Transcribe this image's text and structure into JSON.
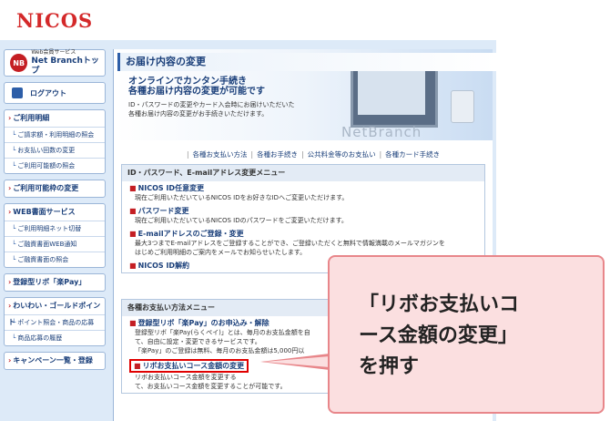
{
  "header": {
    "logo": "NICOS"
  },
  "sidebar": {
    "top": {
      "service_label": "Web会員サービス",
      "title": "Net Branchトップ",
      "badge": "NB"
    },
    "logout_label": "ログアウト",
    "sections": [
      {
        "title": "ご利用明細",
        "items": [
          "ご請求額・利用明細の照会",
          "お支払い回数の変更",
          "ご利用可能額の照会"
        ]
      },
      {
        "title": "ご利用可能枠の変更",
        "items": []
      },
      {
        "title": "WEB書面サービス",
        "items": [
          "ご利用明細ネット切替",
          "ご融資書面WEB通知",
          "ご融資書面の照会"
        ]
      },
      {
        "title": "登録型リボ「楽Pay」",
        "items": []
      },
      {
        "title": "わいわい・ゴールドポイント",
        "items": [
          "ポイント照会・商品の応募",
          "商品応募の履歴"
        ]
      },
      {
        "title": "キャンペーン一覧・登録",
        "items": []
      }
    ]
  },
  "main": {
    "page_title": "お届け内容の変更",
    "banner_heading_1": "オンラインでカンタン手続き",
    "banner_heading_2": "各種お届け内容の変更が可能です",
    "banner_text_1": "ID・パスワードの変更やカード入会時にお届けいただいた",
    "banner_text_2": "各種お届け内容の変更がお手続きいただけます。",
    "brand_mark": "NetBranch",
    "links": [
      "各種お支払い方法",
      "各種お手続き",
      "公共料金等のお支払い",
      "各種カード手続き"
    ],
    "panel1": {
      "title": "ID・パスワード、E-mailアドレス変更メニュー",
      "items": [
        {
          "title": "NICOS ID任意変更",
          "desc": [
            "現在ご利用いただいているNICOS IDをお好きなIDへご変更いただけます。"
          ]
        },
        {
          "title": "パスワード変更",
          "desc": [
            "現在ご利用いただいているNICOS IDのパスワードをご変更いただけます。"
          ]
        },
        {
          "title": "E-mailアドレスのご登録・変更",
          "desc": [
            "最大3つまでE-mailアドレスをご登録することができ、ご登録いただくと無料で情報満載のメールマガジンを",
            "はじめご利用明細のご案内をメールでお知らせいたします。"
          ]
        },
        {
          "title": "NICOS ID解約",
          "desc": []
        }
      ]
    },
    "panel2": {
      "title": "各種お支払い方法メニュー",
      "items": [
        {
          "title": "登録型リボ「楽Pay」のお申込み・解除",
          "desc": [
            "登録型リボ「楽Pay(らくペイ)」とは、毎月のお支払金額を自",
            "て、自由に設定・変更できるサービスです。",
            "「楽Pay」のご登録は無料、毎月のお支払金額は5,000円以"
          ]
        },
        {
          "title": "リボお支払いコース金額の変更",
          "desc": [
            "リボお支払いコース金額を変更する",
            "て、お支払いコース金額を変更することが可能です。"
          ]
        }
      ]
    }
  },
  "callout": {
    "text": "「リボお支払いコ\nース金額の変更」\nを押す"
  },
  "colors": {
    "accent": "#c41e23",
    "link": "#1a3f7a",
    "highlight": "#e00000",
    "callout_bg": "#fbdfe0"
  }
}
